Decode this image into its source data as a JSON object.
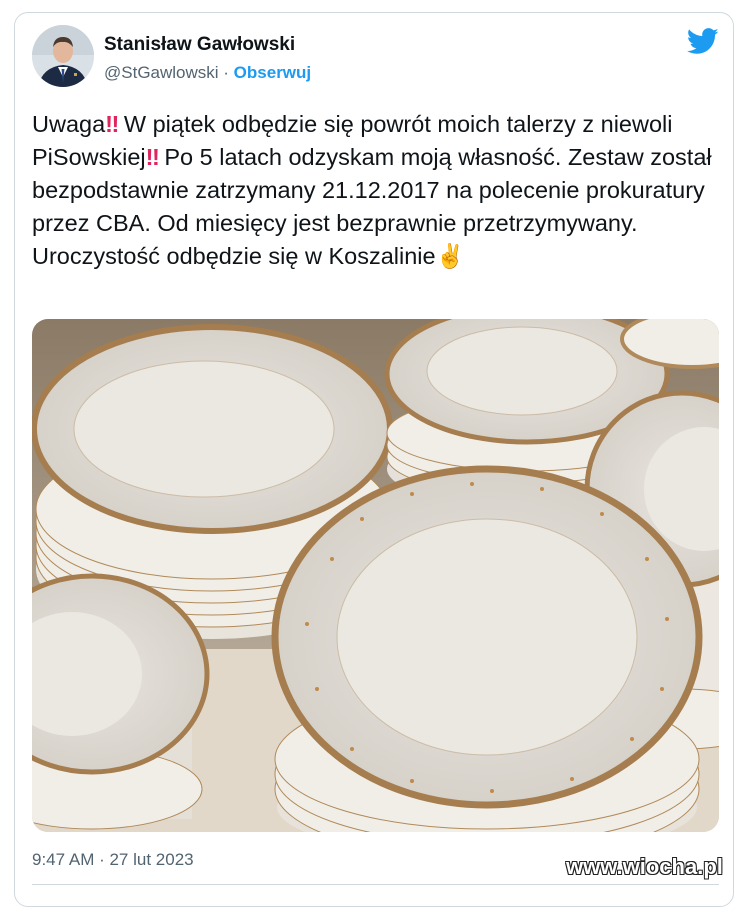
{
  "author": {
    "name": "Stanisław Gawłowski",
    "handle": "@StGawlowski",
    "separator": " · ",
    "follow_label": "Obserwuj"
  },
  "tweet": {
    "seg1": "Uwaga",
    "seg2": " W piątek odbędzie się powrót moich talerzy z niewoli PiSowskiej",
    "seg3": " Po 5 latach odzyskam moją własność. Zestaw został bezpodstawnie zatrzymany 21.12.2017 na polecenie prokuratury przez CBA. Od miesięcy jest bezprawnie przetrzymywany. Uroczystość odbędzie się w Koszalinie",
    "bang_emoji": "‼",
    "victory_emoji": "✌"
  },
  "timestamp": "9:47 AM · 27 lut 2023",
  "watermark": "www.wiocha.pl",
  "colors": {
    "link_blue": "#1d9bf0",
    "text": "#0f1419",
    "muted": "#536471",
    "emoji_red": "#e0245e"
  },
  "icons": {
    "twitter": "twitter-bird-icon",
    "avatar": "avatar"
  }
}
